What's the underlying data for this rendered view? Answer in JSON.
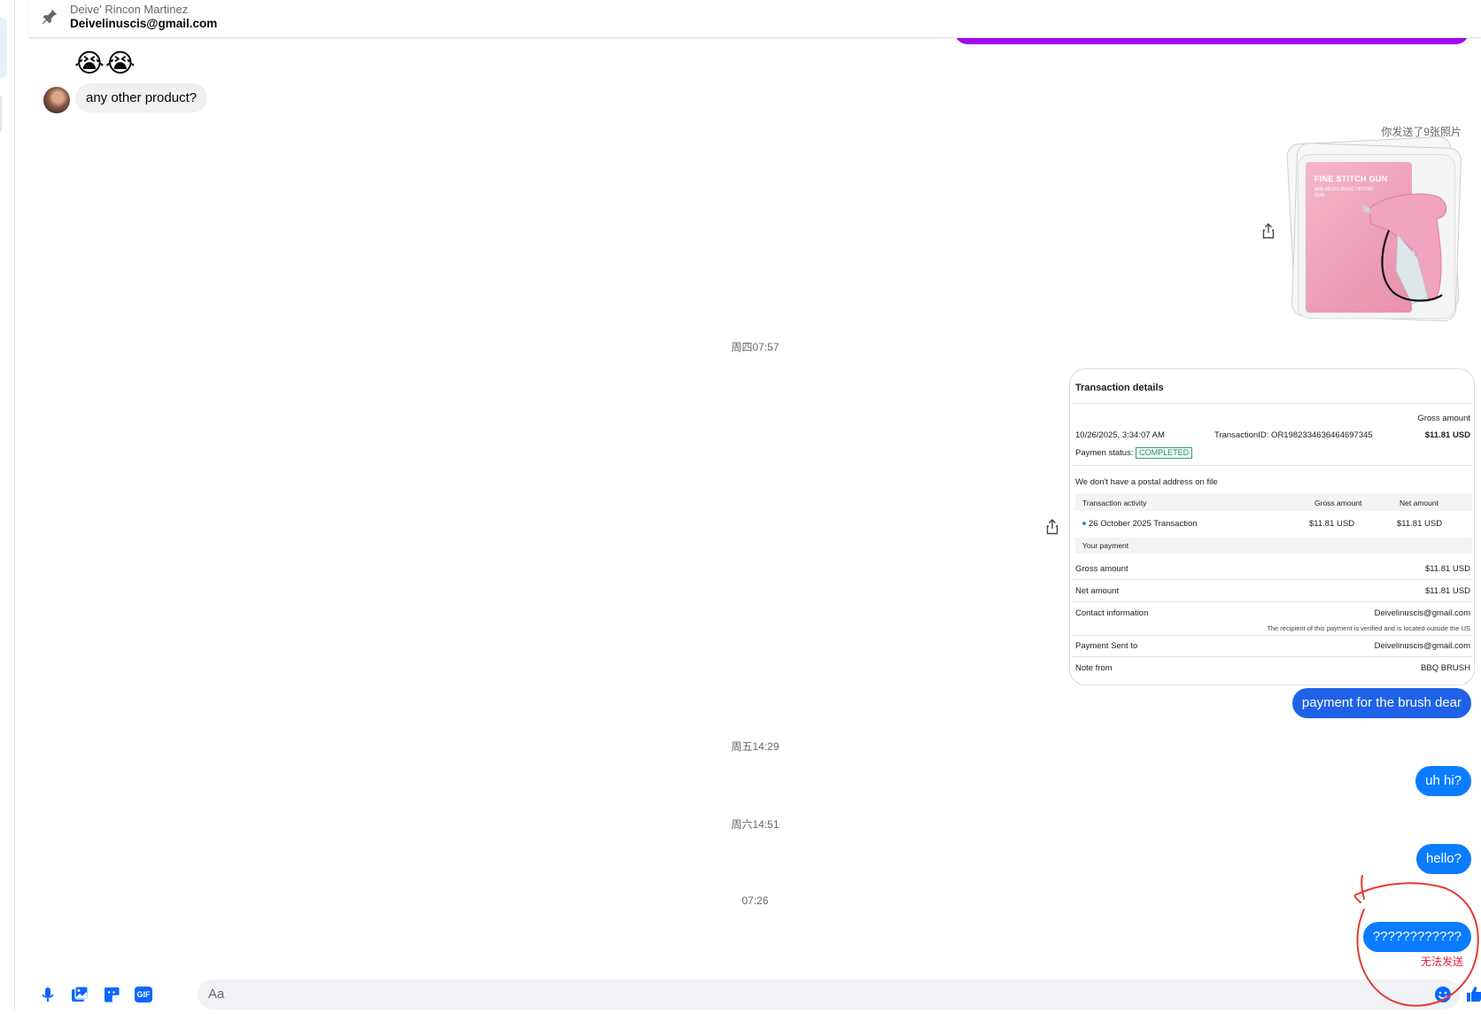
{
  "header": {
    "name": "Deive' Rincon Martinez",
    "email": "Deivelinuscis@gmail.com"
  },
  "messages": {
    "emoji": "😭😭",
    "incoming": "any other product?",
    "sent_photos_label": "你发送了9张照片",
    "photo_title": "FINE STITCH GUN",
    "photo_subtitle": "MINI MICRO BASIC TATTOO GUN",
    "ts1": "周四07:57",
    "payment_msg": "payment for the brush dear",
    "ts2": "周五14:29",
    "uh_hi": "uh hi?",
    "ts3": "周六14:51",
    "hello": "hello?",
    "ts4": "07:26",
    "qmarks": "????????????",
    "failed": "无法发送"
  },
  "receipt": {
    "title": "Transaction details",
    "gross_header": "Gross amount",
    "date": "10/26/2025, 3:34:07 AM",
    "transaction_id": "TransactionID: OR1982334636464697345",
    "gross_value": "$11.81 USD",
    "status_label": "Paymen status:",
    "status_value": "COMPLETED",
    "postal_note": "We don't have a postal address on file",
    "col_activity": "Transaction activity",
    "col_gross": "Gross amount",
    "col_net": "Net amount",
    "row_label": "26 October 2025 Transaction",
    "row_gross": "$11.81 USD",
    "row_net": "$11.81 USD",
    "your_payment": "Your payment",
    "gross_label": "Gross amount",
    "gross_amount": "$11.81 USD",
    "net_label": "Net amount",
    "net_amount": "$11.81 USD",
    "contact_label": "Contact information",
    "contact_value": "Deivelinuscis@gmail.com",
    "recipient_note": "The recipient of this payment is verified and is located outside the US",
    "sent_to_label": "Payment Sent to",
    "sent_to_value": "Deivelinuscis@gmail.com",
    "note_label": "Note from",
    "note_value": "BBQ BRUSH"
  },
  "composer": {
    "placeholder": "Aa",
    "icons": [
      "microphone-icon",
      "photo-icon",
      "sticker-icon",
      "gif-icon",
      "emoji-icon",
      "thumbs-up-icon"
    ],
    "gif_label": "GIF"
  },
  "colors": {
    "outgoing_bubble": "#0a7cff",
    "first_outgoing_bubble": "#1f62e8",
    "incoming_bubble": "#f0f0f0",
    "purple_bar": "#a30cf0",
    "annotation": "#e53935",
    "failed_text": "#e41e3f"
  }
}
